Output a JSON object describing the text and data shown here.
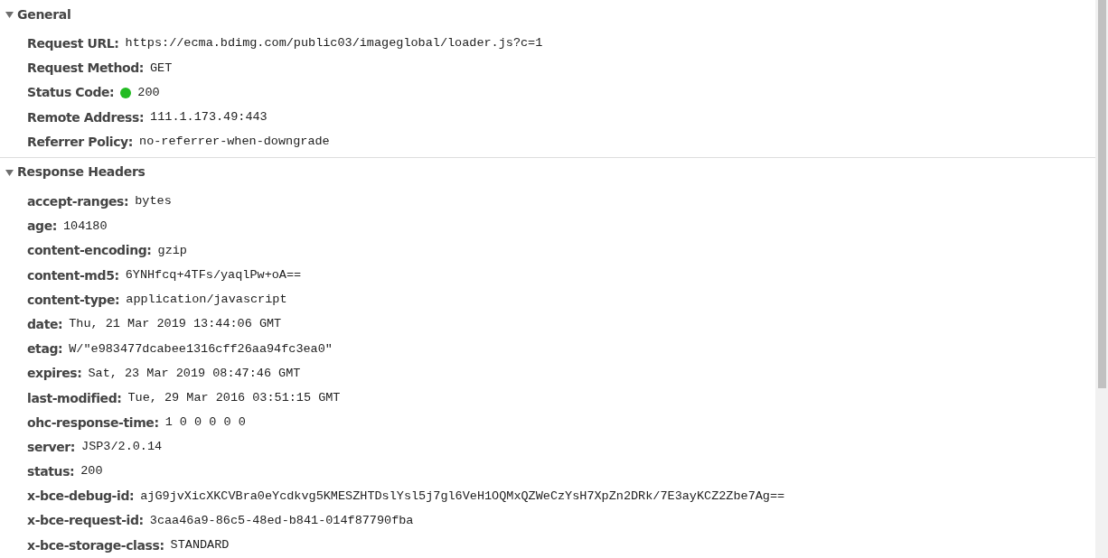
{
  "sections": [
    {
      "title": "General",
      "expanded": true,
      "rows": [
        {
          "name": "Request URL:",
          "value": "https://ecma.bdimg.com/public03/imageglobal/loader.js?c=1"
        },
        {
          "name": "Request Method:",
          "value": "GET"
        },
        {
          "name": "Status Code:",
          "value": "200",
          "color": "#22bb22"
        },
        {
          "name": "Remote Address:",
          "value": "111.1.173.49:443"
        },
        {
          "name": "Referrer Policy:",
          "value": "no-referrer-when-downgrade"
        }
      ]
    },
    {
      "title": "Response Headers",
      "expanded": true,
      "rows": [
        {
          "name": "accept-ranges:",
          "value": "bytes"
        },
        {
          "name": "age:",
          "value": "104180"
        },
        {
          "name": "content-encoding:",
          "value": "gzip"
        },
        {
          "name": "content-md5:",
          "value": "6YNHfcq+4TFs/yaqlPw+oA=="
        },
        {
          "name": "content-type:",
          "value": "application/javascript"
        },
        {
          "name": "date:",
          "value": "Thu, 21 Mar 2019 13:44:06 GMT"
        },
        {
          "name": "etag:",
          "value": "W/\"e983477dcabee1316cff26aa94fc3ea0\""
        },
        {
          "name": "expires:",
          "value": "Sat, 23 Mar 2019 08:47:46 GMT"
        },
        {
          "name": "last-modified:",
          "value": "Tue, 29 Mar 2016 03:51:15 GMT"
        },
        {
          "name": "ohc-response-time:",
          "value": "1 0 0 0 0 0"
        },
        {
          "name": "server:",
          "value": "JSP3/2.0.14"
        },
        {
          "name": "status:",
          "value": "200"
        },
        {
          "name": "x-bce-debug-id:",
          "value": "ajG9jvXicXKCVBra0eYcdkvg5KMESZHTDslYsl5j7gl6VeH1OQMxQZWeCzYsH7XpZn2DRk/7E3ayKCZ2Zbe7Ag=="
        },
        {
          "name": "x-bce-request-id:",
          "value": "3caa46a9-86c5-48ed-b841-014f87790fba"
        },
        {
          "name": "x-bce-storage-class:",
          "value": "STANDARD"
        }
      ]
    }
  ]
}
